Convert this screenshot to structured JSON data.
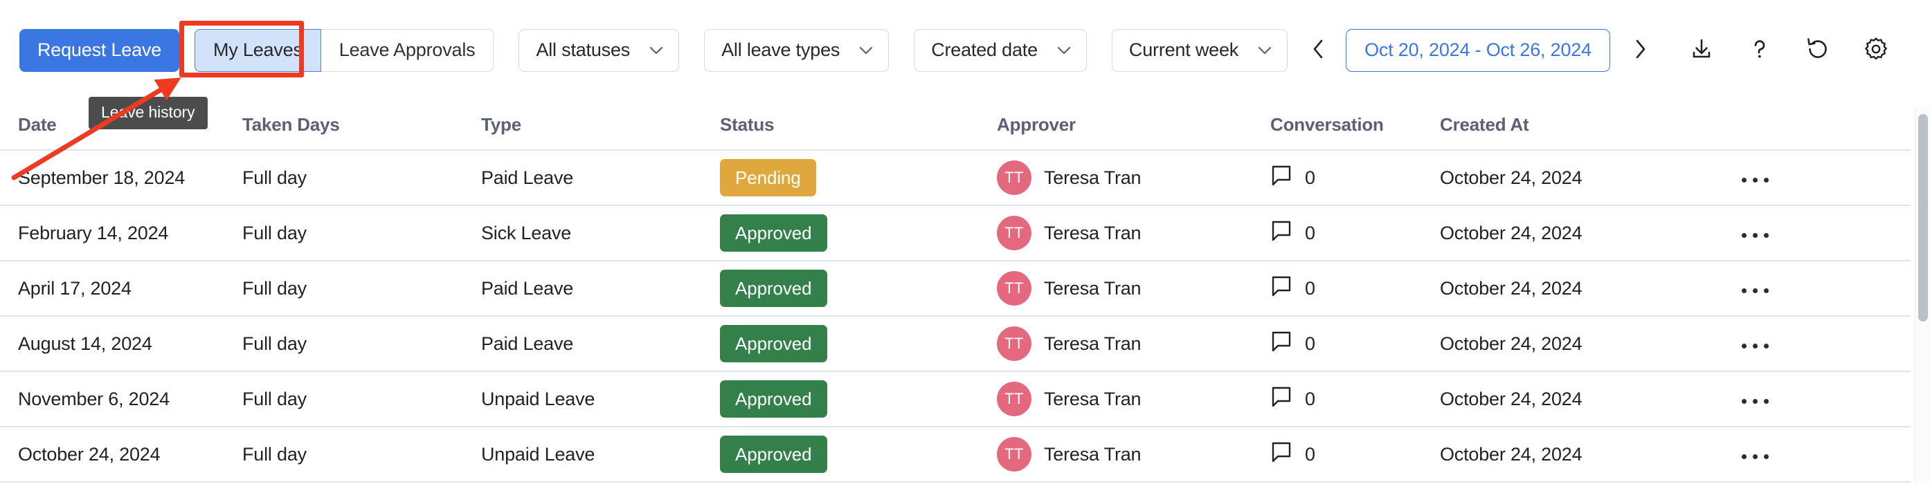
{
  "toolbar": {
    "request_leave_label": "Request Leave",
    "tabs": [
      {
        "label": "My Leaves",
        "active": true
      },
      {
        "label": "Leave Approvals",
        "active": false
      }
    ],
    "filters": [
      {
        "name": "status-filter",
        "value": "All statuses"
      },
      {
        "name": "leave-type-filter",
        "value": "All leave types"
      },
      {
        "name": "date-field-filter",
        "value": "Created date"
      },
      {
        "name": "period-filter",
        "value": "Current week"
      }
    ],
    "prev_label": "‹",
    "next_label": "›",
    "date_range": "Oct 20, 2024 - Oct 26, 2024",
    "icons": [
      {
        "name": "download-icon",
        "title": "Download"
      },
      {
        "name": "help-icon",
        "title": "Help"
      },
      {
        "name": "refresh-icon",
        "title": "Refresh"
      },
      {
        "name": "settings-gear-icon",
        "title": "Settings"
      }
    ]
  },
  "annotation": {
    "tooltip_text": "Leave history",
    "highlight_color": "#EF3A22",
    "arrow_color": "#EF3A22"
  },
  "table": {
    "columns": [
      "Date",
      "Taken Days",
      "Type",
      "Status",
      "Approver",
      "Conversation",
      "Created At"
    ],
    "rows": [
      {
        "date": "September 18, 2024",
        "taken_days": "Full day",
        "type": "Paid Leave",
        "status": "Pending",
        "status_variant": "pending",
        "approver_initials": "TT",
        "approver": "Teresa Tran",
        "conversation": "0",
        "created_at": "October 24, 2024"
      },
      {
        "date": "February 14, 2024",
        "taken_days": "Full day",
        "type": "Sick Leave",
        "status": "Approved",
        "status_variant": "approved",
        "approver_initials": "TT",
        "approver": "Teresa Tran",
        "conversation": "0",
        "created_at": "October 24, 2024"
      },
      {
        "date": "April 17, 2024",
        "taken_days": "Full day",
        "type": "Paid Leave",
        "status": "Approved",
        "status_variant": "approved",
        "approver_initials": "TT",
        "approver": "Teresa Tran",
        "conversation": "0",
        "created_at": "October 24, 2024"
      },
      {
        "date": "August 14, 2024",
        "taken_days": "Full day",
        "type": "Paid Leave",
        "status": "Approved",
        "status_variant": "approved",
        "approver_initials": "TT",
        "approver": "Teresa Tran",
        "conversation": "0",
        "created_at": "October 24, 2024"
      },
      {
        "date": "November 6, 2024",
        "taken_days": "Full day",
        "type": "Unpaid Leave",
        "status": "Approved",
        "status_variant": "approved",
        "approver_initials": "TT",
        "approver": "Teresa Tran",
        "conversation": "0",
        "created_at": "October 24, 2024"
      },
      {
        "date": "October 24, 2024",
        "taken_days": "Full day",
        "type": "Unpaid Leave",
        "status": "Approved",
        "status_variant": "approved",
        "approver_initials": "TT",
        "approver": "Teresa Tran",
        "conversation": "0",
        "created_at": "October 24, 2024"
      }
    ]
  },
  "colors": {
    "primary_blue": "#3B77E3",
    "active_tab_bg": "#D3E2FB",
    "pending_badge": "#DFA83D",
    "approved_badge": "#33804A",
    "avatar_pink": "#E4697F",
    "header_text": "#5C6075"
  }
}
